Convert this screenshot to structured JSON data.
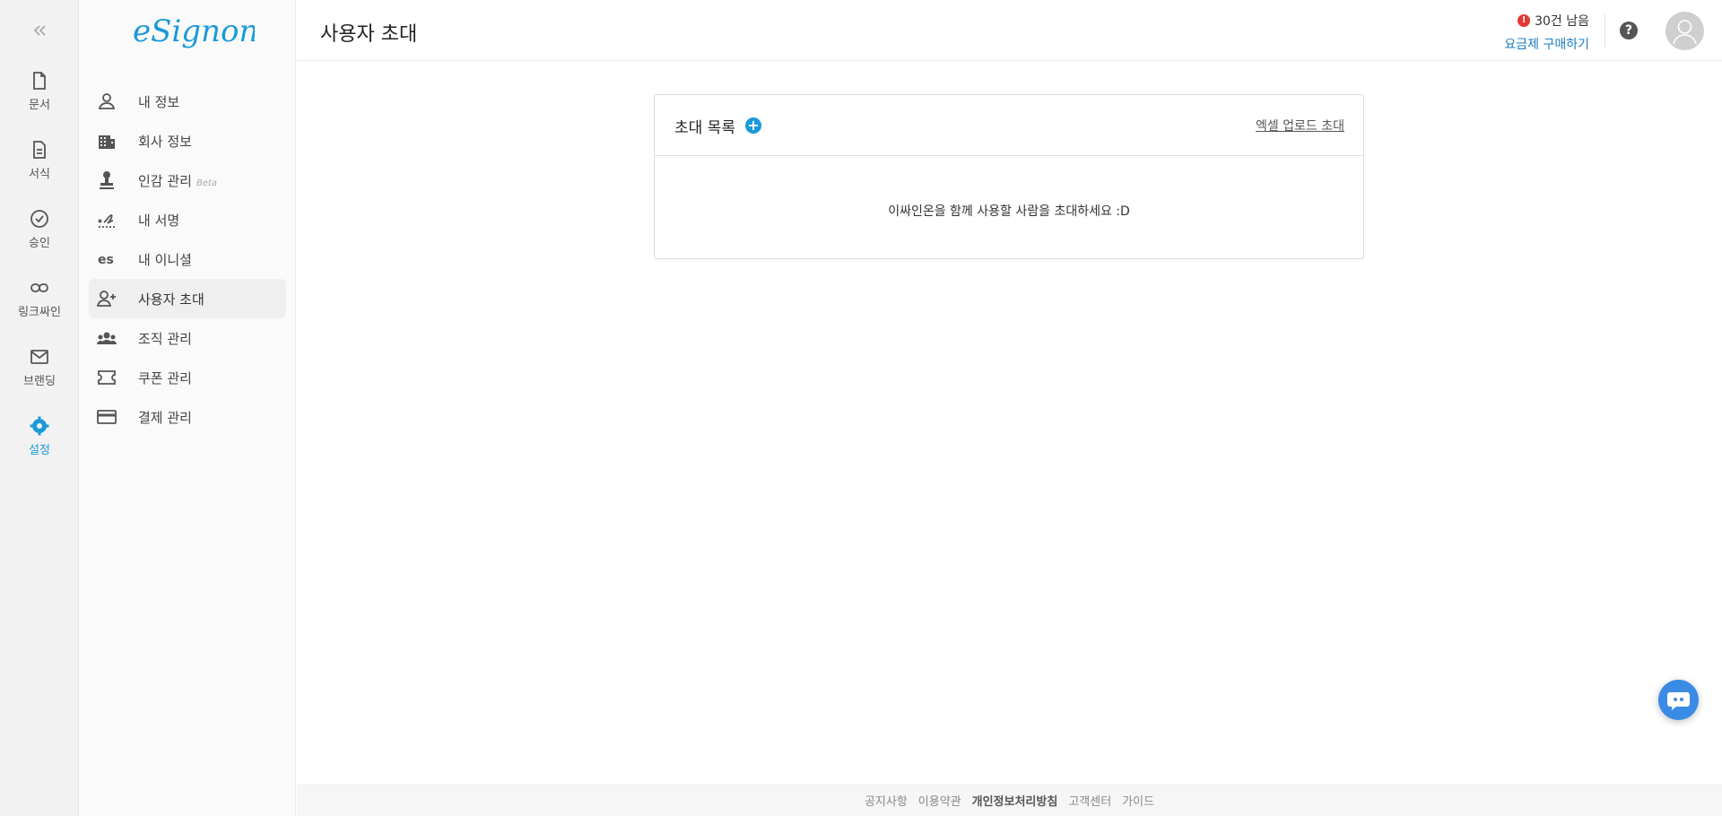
{
  "rail": {
    "items": [
      {
        "label": "문서",
        "icon": "document-icon"
      },
      {
        "label": "서식",
        "icon": "form-template-icon"
      },
      {
        "label": "승인",
        "icon": "check-circle-icon"
      },
      {
        "label": "링크싸인",
        "icon": "link-icon"
      },
      {
        "label": "브랜딩",
        "icon": "mail-icon"
      },
      {
        "label": "설정",
        "icon": "gear-icon",
        "active": true
      }
    ]
  },
  "brand": {
    "logo_text": "eSignon",
    "accent": "#1a9ad8"
  },
  "submenu": {
    "items": [
      {
        "label": "내 정보",
        "icon": "person-icon"
      },
      {
        "label": "회사 정보",
        "icon": "building-icon"
      },
      {
        "label": "인감 관리",
        "badge": "Beta",
        "icon": "stamp-icon"
      },
      {
        "label": "내 서명",
        "icon": "signature-icon"
      },
      {
        "label": "내 이니셜",
        "icon": "initials-icon",
        "icon_text": "es"
      },
      {
        "label": "사용자 초대",
        "icon": "person-add-icon",
        "active": true
      },
      {
        "label": "조직 관리",
        "icon": "group-icon"
      },
      {
        "label": "쿠폰 관리",
        "icon": "ticket-icon"
      },
      {
        "label": "결제 관리",
        "icon": "credit-card-icon"
      }
    ]
  },
  "header": {
    "title": "사용자 초대",
    "quota_alert": "!",
    "quota_text": "30건 남음",
    "upgrade_label": "요금제 구매하기",
    "help_label": "?"
  },
  "invite_card": {
    "title": "초대 목록",
    "add_label": "+",
    "excel_label": "엑셀 업로드 초대",
    "empty_message": "이싸인온을 함께 사용할 사람을 초대하세요 :D"
  },
  "footer": {
    "links": [
      "공지사항",
      "이용약관",
      "개인정보처리방침",
      "고객센터",
      "가이드"
    ]
  }
}
